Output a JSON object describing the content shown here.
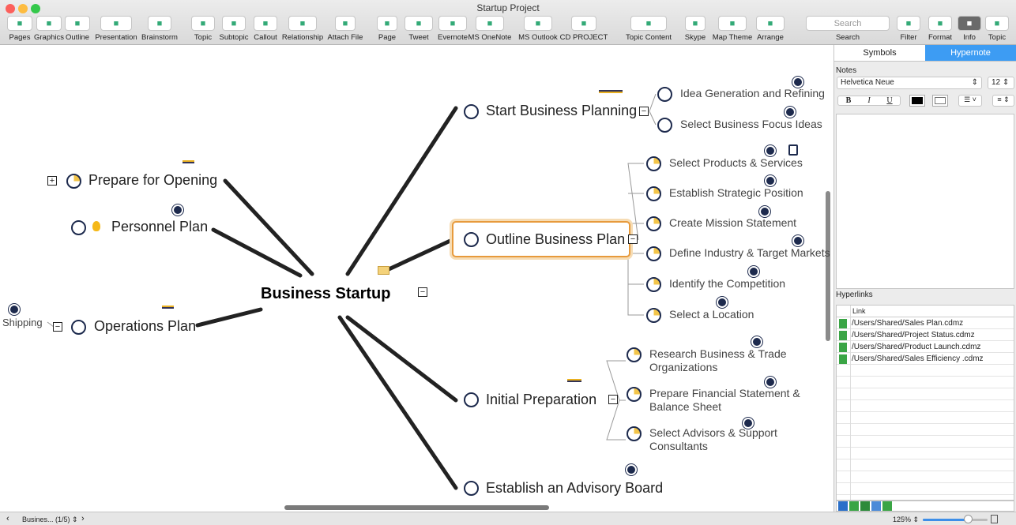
{
  "window": {
    "title": "Startup Project"
  },
  "toolbar": [
    {
      "label": "Pages",
      "icon": "pages-icon"
    },
    {
      "label": "Graphics",
      "icon": "graphics-icon"
    },
    {
      "label": "Outline",
      "icon": "outline-icon"
    },
    {
      "label": "Presentation",
      "icon": "presentation-icon"
    },
    {
      "label": "Brainstorm",
      "icon": "brainstorm-icon"
    },
    {
      "label": "Topic",
      "icon": "topic-icon"
    },
    {
      "label": "Subtopic",
      "icon": "subtopic-icon"
    },
    {
      "label": "Callout",
      "icon": "callout-icon"
    },
    {
      "label": "Relationship",
      "icon": "relationship-icon"
    },
    {
      "label": "Attach File",
      "icon": "paperclip-icon"
    },
    {
      "label": "Page",
      "icon": "page-icon"
    },
    {
      "label": "Tweet",
      "icon": "twitter-icon"
    },
    {
      "label": "Evernote",
      "icon": "evernote-icon"
    },
    {
      "label": "MS OneNote",
      "icon": "onenote-icon"
    },
    {
      "label": "MS Outlook",
      "icon": "outlook-icon"
    },
    {
      "label": "CD PROJECT",
      "icon": "cdproject-icon"
    },
    {
      "label": "Topic Content",
      "icon": "topic-content-icon"
    },
    {
      "label": "Skype",
      "icon": "skype-icon"
    },
    {
      "label": "Map Theme",
      "icon": "map-theme-icon"
    },
    {
      "label": "Arrange",
      "icon": "arrange-icon"
    },
    {
      "label": "Search",
      "placeholder": "Search"
    },
    {
      "label": "Filter",
      "icon": "filter-icon"
    },
    {
      "label": "Format",
      "icon": "format-icon"
    },
    {
      "label": "Info",
      "icon": "info-icon"
    },
    {
      "label": "Topic",
      "icon": "topic-panel-icon"
    }
  ],
  "map": {
    "central": "Business Startup",
    "branches": {
      "start": "Start Business Planning",
      "outline": "Outline Business Plan",
      "initial": "Initial Preparation",
      "advisory": "Establish an Advisory Board",
      "prepare": "Prepare for Opening",
      "personnel": "Personnel Plan",
      "operations": "Operations Plan",
      "shipping": "Shipping"
    },
    "start_subs": [
      "Idea Generation and Refining",
      "Select Business Focus Ideas"
    ],
    "outline_subs": [
      "Select Products & Services",
      "Establish Strategic Position",
      "Create Mission Statement",
      "Define Industry & Target Markets",
      "Identify the Competition",
      "Select a Location"
    ],
    "initial_subs": [
      [
        "Research Business & Trade",
        "Organizations"
      ],
      [
        "Prepare Financial Statement &",
        "Balance Sheet"
      ],
      [
        "Select Advisors & Support",
        "Consultants"
      ]
    ]
  },
  "panel": {
    "tabs": [
      "Symbols",
      "Hypernote"
    ],
    "notes_label": "Notes",
    "font": "Helvetica Neue",
    "size": "12",
    "bold": "B",
    "italic": "I",
    "underline": "U",
    "hyperlinks_label": "Hyperlinks",
    "link_header": "Link",
    "links": [
      "/Users/Shared/Sales Plan.cdmz",
      "/Users/Shared/Project Status.cdmz",
      "/Users/Shared/Product Launch.cdmz",
      "/Users/Shared/Sales Efficiency .cdmz"
    ]
  },
  "status": {
    "page": "Busines... (1/5)",
    "zoom": "125%",
    "zoom_slider": 0.7
  }
}
